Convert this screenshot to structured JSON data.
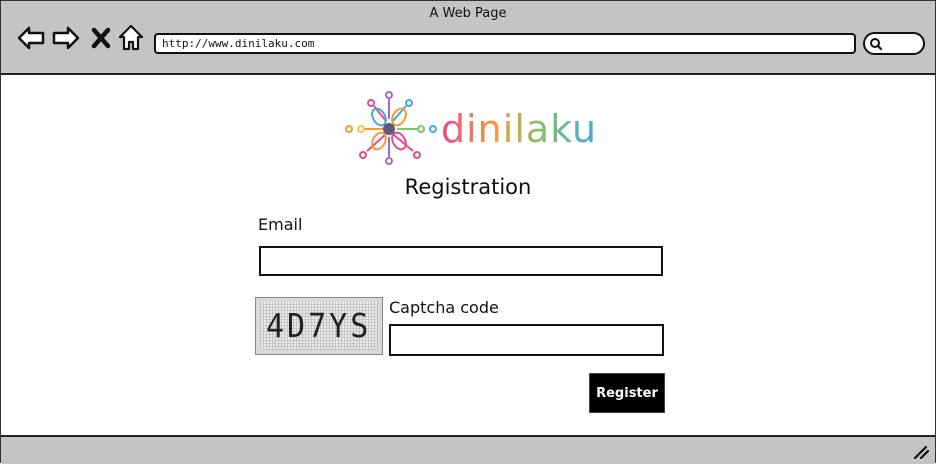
{
  "browser": {
    "title": "A Web Page",
    "url": "http://www.dinilaku.com",
    "icons": [
      "back-arrow-icon",
      "forward-arrow-icon",
      "close-icon",
      "home-icon",
      "search-icon"
    ]
  },
  "logo": {
    "text": "dinilaku",
    "colors": [
      "#e84a8a",
      "#f29a3a",
      "#f5c542",
      "#7fc46b",
      "#4aa7d8",
      "#9b6bc7"
    ]
  },
  "form": {
    "heading": "Registration",
    "email_label": "Email",
    "email_value": "",
    "captcha_text": "4D7YS",
    "captcha_label": "Captcha code",
    "captcha_value": "",
    "register_label": "Register"
  }
}
